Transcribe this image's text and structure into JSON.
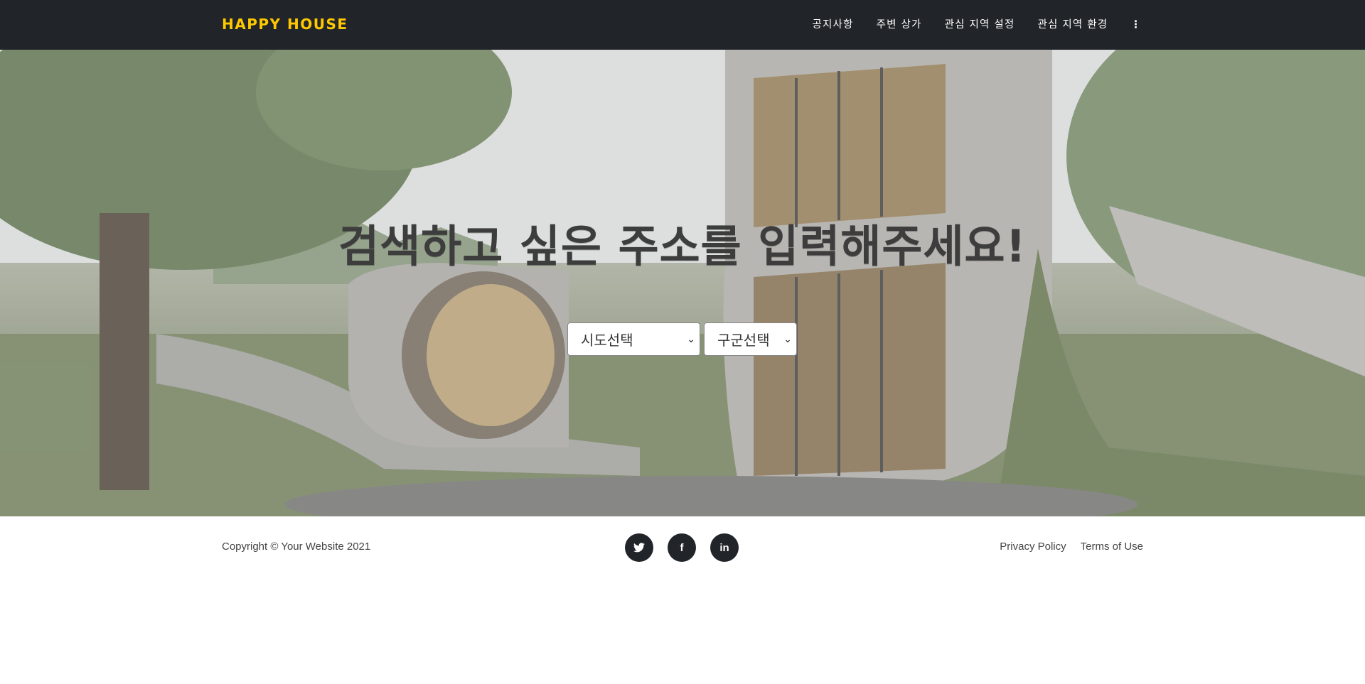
{
  "navbar": {
    "brand": "HAPPY HOUSE",
    "items": [
      {
        "label": "공지사항"
      },
      {
        "label": "주변 상가"
      },
      {
        "label": "관심 지역 설정"
      },
      {
        "label": "관심 지역 환경"
      }
    ],
    "more_label": "⋮"
  },
  "hero": {
    "title": "검색하고 싶은 주소를 입력해주세요!",
    "sido_select": {
      "selected": "시도선택"
    },
    "gugun_select": {
      "selected": "구군선택"
    }
  },
  "footer": {
    "copyright": "Copyright © Your Website 2021",
    "social": [
      {
        "icon": "twitter-icon",
        "glyph": "🐦"
      },
      {
        "icon": "facebook-icon",
        "glyph": "f"
      },
      {
        "icon": "linkedin-icon",
        "glyph": "in"
      }
    ],
    "links": [
      {
        "label": "Privacy Policy"
      },
      {
        "label": "Terms of Use"
      }
    ]
  },
  "colors": {
    "navbar_bg": "#212529",
    "brand": "#ffc800",
    "hero_title": "#3d3d3d"
  }
}
